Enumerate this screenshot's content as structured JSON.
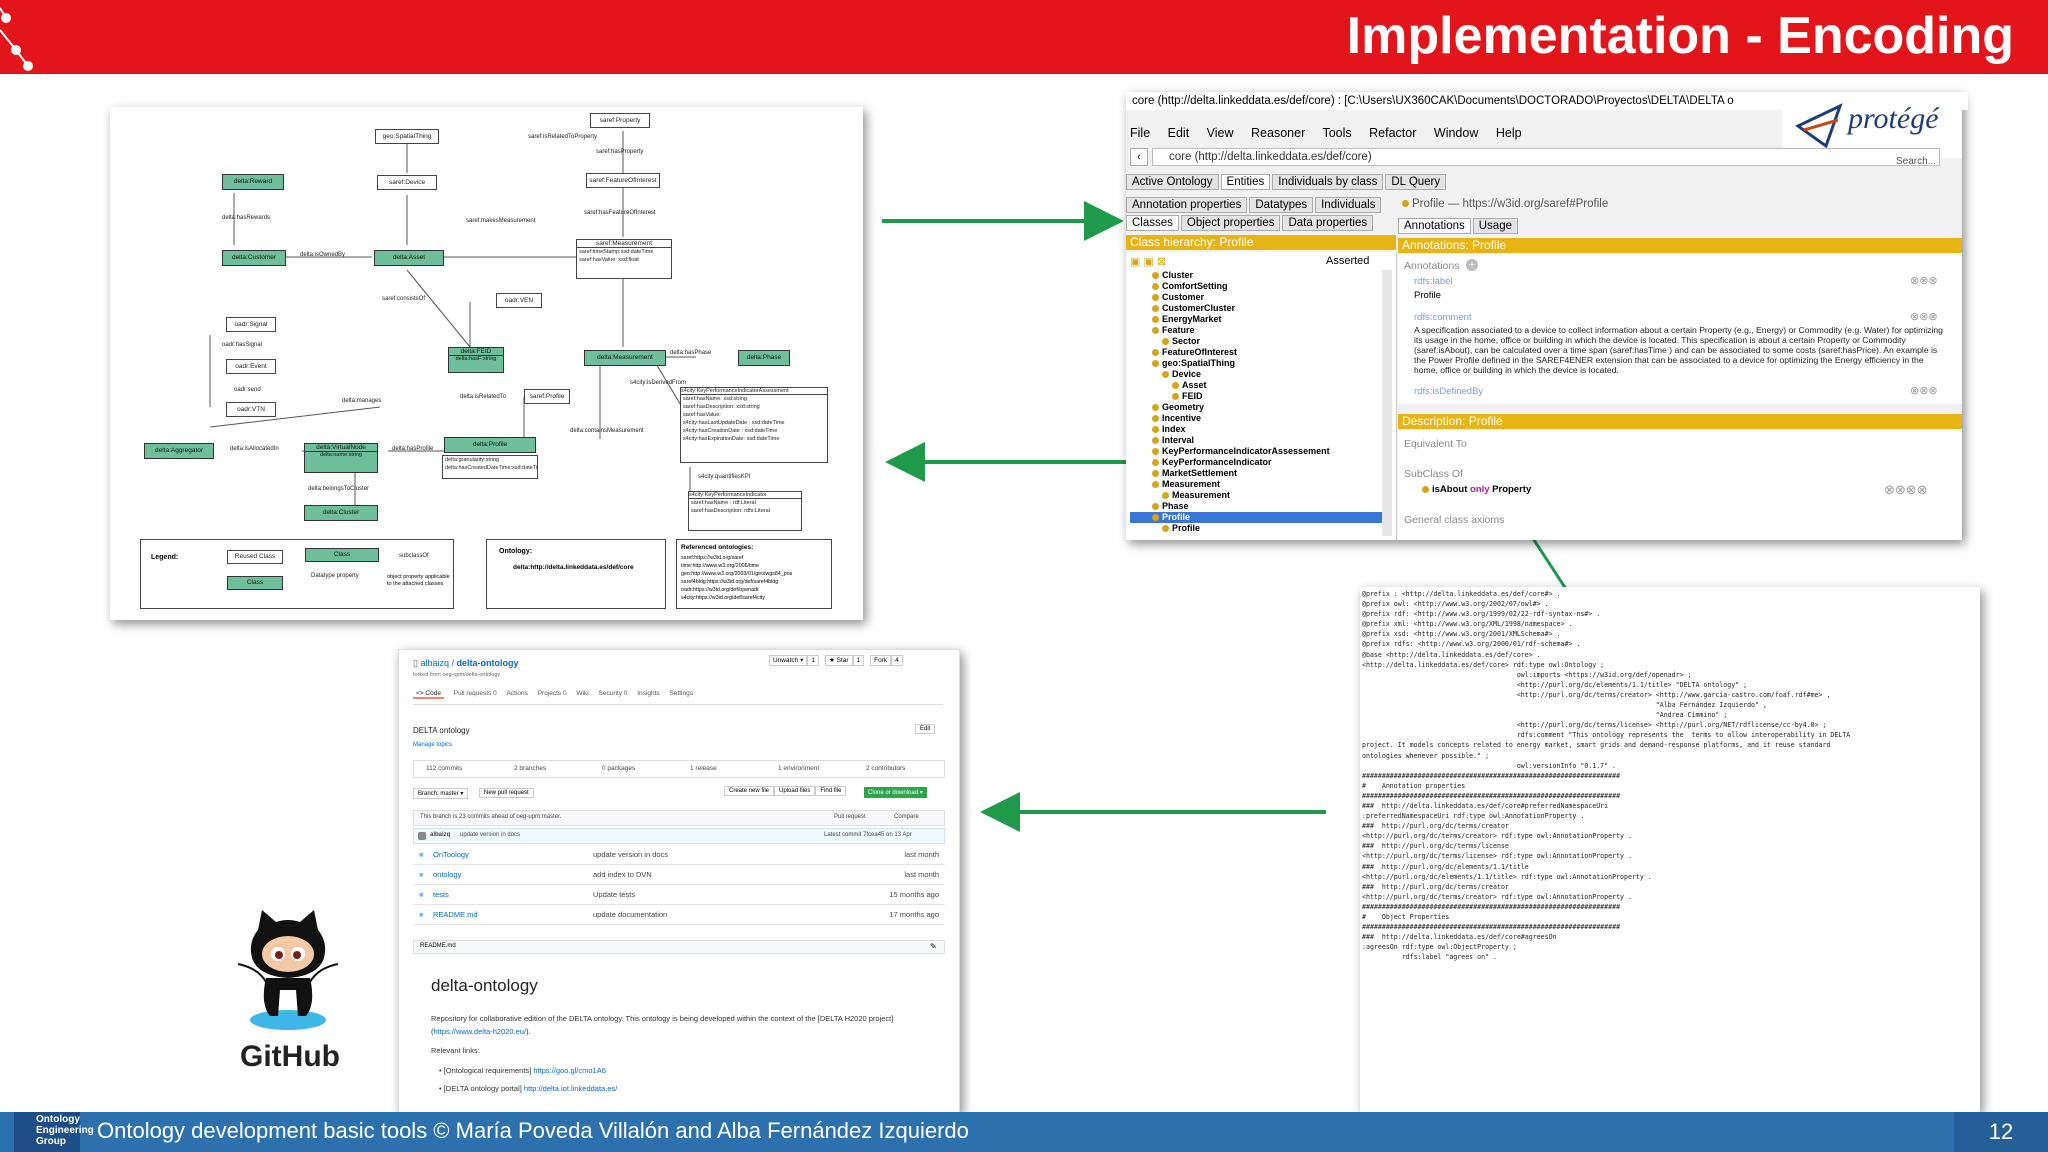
{
  "slide": {
    "title": "Implementation - Encoding",
    "footer_text": "Ontology development basic tools  © María Poveda Villalón  and Alba Fernández Izquierdo",
    "page_number": "12",
    "footer_logo_lines": [
      "Ontology",
      "Engineering",
      "Group"
    ],
    "colors": {
      "header": "#e3151b",
      "footer": "#2c70ae",
      "arrow": "#1f9a4a",
      "protege_bar": "#e7b416"
    }
  },
  "diagram": {
    "legend": {
      "title": "Legend:",
      "reused_class": "Reused Class",
      "class": "Class",
      "class2": "Class",
      "subclass_of": "subclassOf",
      "datatype_property": "Datatype property",
      "object_property": "object property applicable to the attached classes"
    },
    "ontology_label": "Ontology:",
    "ontology_uri": "delta:http://delta.linkeddata.es/def/core",
    "referenced_title": "Referenced ontologies:",
    "referenced": [
      "saref:https://w3id.org/saref",
      "time:http://www.w3.org/2006/time",
      "geo:http://www.w3.org/2003/01/geo/wgs84_pos",
      "saref4bldg:https://w3id.org/def/saref4bldg",
      "oadr:https://w3id.org/def/openadr",
      "s4city:https://w3id.org/def/saref4city"
    ],
    "nodes": {
      "reward": "delta:Reward",
      "customer": "delta:Customer",
      "asset": "delta:Asset",
      "device": "saref:Device",
      "spatial": "geo:SpatialThing",
      "property": "saref:Property",
      "feature": "saref:FeatureOfInterest",
      "measurement": "saref:Measurement",
      "feid": "delta:FEID",
      "dmeasurement": "delta:Measurement",
      "phase": "delta:Phase",
      "signal": "oadr:Signal",
      "event": "oadr:Event",
      "vtn": "oadr:VTN",
      "ven": "oadr:VEN",
      "aggregator": "delta:Aggregator",
      "virtualnode": "delta:VirtualNode",
      "dcluster": "delta:Cluster",
      "sprofile": "saref:Profile",
      "dprofile": "delta:Profile",
      "kpiassess": "s4city:KeyPerformanceIndicatorAssessment",
      "kpi": "s4city:KeyPerformanceIndicator"
    },
    "edges": {
      "hasRewards": "delta:hasRewards",
      "isOwnedBy": "delta:isOwnedBy",
      "isRelatedToProperty": "saref:isRelatedToProperty",
      "hasProperty": "saref:hasProperty",
      "makesMeasurement": "saref:makesMeasurement",
      "hasFeatureOfInterest": "saref:hasFeatureOfInterest",
      "consistsOf": "saref:consistsOf",
      "hasSignal": "oadr:hasSignal",
      "send": "oadr:send",
      "manages": "delta:manages",
      "isAllocatedIn": "delta:isAllocatedIn",
      "hasProfile": "delta:hasProfile",
      "belongsToCluster": "delta:belongsToCluster",
      "isRelatedTo": "delta:isRelatedTo",
      "containsMeasurement": "delta:containsMeasurement",
      "hasPhase": "delta:hasPhase",
      "isDerivedFrom": "s4city:isDerivedFrom",
      "quantifiesKPI": "s4city:quantifiesKPI"
    },
    "attrs": {
      "feid": "delta:hasF:string",
      "measurement": "saref:timeStamp:xsd:dateTime\nsaref:hasValue: xsd:float",
      "virtualnode": "delta:name:string",
      "dprofile": "delta:granularity:string\ndelta:hasCreatedDateTime:xsd:dateTime",
      "kpiassess": "saref:hasName: xsd:string\nsaref:hasDescription: xsd:string\nsaref:hasValue:\ns4city:hasLastUpdateDate : xsd:dateTime\ns4city:hasCreationDate : xsd:dateTime\ns4city:hasExpirationDate: xsd:dateTime",
      "kpi": "saref:hasName : rdf:Literal\nsaref:hasDescription: rdfs:Literal"
    }
  },
  "protege": {
    "window_title": "core (http://delta.linkeddata.es/def/core) : [C:\\Users\\UX360CAK\\Documents\\DOCTORADO\\Proyectos\\DELTA\\DELTA o",
    "logo_text": "protégé",
    "menu": [
      "File",
      "Edit",
      "View",
      "Reasoner",
      "Tools",
      "Refactor",
      "Window",
      "Help"
    ],
    "address": "core (http://delta.linkeddata.es/def/core)",
    "search_label": "Search...",
    "tabs": [
      "Active Ontology",
      "Entities",
      "Individuals by class",
      "DL Query"
    ],
    "left_tabs_row1": [
      "Annotation properties",
      "Datatypes",
      "Individuals"
    ],
    "left_tabs_row2": [
      "Classes",
      "Object properties",
      "Data properties"
    ],
    "class_hierarchy_label": "Class hierarchy: Profile",
    "asserted_label": "Asserted",
    "tree": [
      {
        "label": "Cluster",
        "indent": 1
      },
      {
        "label": "ComfortSetting",
        "indent": 1
      },
      {
        "label": "Customer",
        "indent": 1
      },
      {
        "label": "CustomerCluster",
        "indent": 1
      },
      {
        "label": "EnergyMarket",
        "indent": 1
      },
      {
        "label": "Feature",
        "indent": 1
      },
      {
        "label": "Sector",
        "indent": 2
      },
      {
        "label": "FeatureOfInterest",
        "indent": 1
      },
      {
        "label": "geo:SpatialThing",
        "indent": 1
      },
      {
        "label": "Device",
        "indent": 2
      },
      {
        "label": "Asset",
        "indent": 3
      },
      {
        "label": "FEID",
        "indent": 3
      },
      {
        "label": "Geometry",
        "indent": 1
      },
      {
        "label": "Incentive",
        "indent": 1
      },
      {
        "label": "Index",
        "indent": 1
      },
      {
        "label": "Interval",
        "indent": 1
      },
      {
        "label": "KeyPerformanceIndicatorAssessement",
        "indent": 1
      },
      {
        "label": "KeyPerformanceIndicator",
        "indent": 1
      },
      {
        "label": "MarketSettlement",
        "indent": 1
      },
      {
        "label": "Measurement",
        "indent": 1
      },
      {
        "label": "Measurement",
        "indent": 2
      },
      {
        "label": "Phase",
        "indent": 1
      },
      {
        "label": "Profile",
        "indent": 1,
        "selected": true
      },
      {
        "label": "Profile",
        "indent": 2
      }
    ],
    "entity_header": "Profile — https://w3id.org/saref#Profile",
    "right_tabs": [
      "Annotations",
      "Usage"
    ],
    "annotations_bar": "Annotations: Profile",
    "annotations_label": "Annotations",
    "rdfs_label": "rdfs:label",
    "label_value": "Profile",
    "rdfs_comment": "rdfs:comment",
    "comment_text": "A specification associated to a device to collect information about a certain Property (e.g., Energy) or Commodity (e.g. Water) for optimizing its usage in the home, office or building in which the device is located. This specification is about a certain Property or Commodity (saref:isAbout), can be calculated over a time span (saref:hasTime ) and can be associated to some costs (saref:hasPrice). An example is the Power Profile defined in the SAREF4ENER extension that can be associated to a device for optimizing the Energy efficiency in the home, office or building in which the device is located.",
    "rdfs_defined": "rdfs:isDefinedBy",
    "description_bar": "Description: Profile",
    "equivalent_to": "Equivalent To",
    "subclass_of": "SubClass Of",
    "subclass_value_a": "isAbout",
    "subclass_value_b": "only",
    "subclass_value_c": "Property",
    "general_axioms": "General class axioms"
  },
  "ttl": {
    "lines": [
      "@prefix : <http://delta.linkeddata.es/def/core#> .",
      "@prefix owl: <http://www.w3.org/2002/07/owl#> .",
      "@prefix rdf: <http://www.w3.org/1999/02/22-rdf-syntax-ns#> .",
      "@prefix xml: <http://www.w3.org/XML/1998/namespace> .",
      "@prefix xsd: <http://www.w3.org/2001/XMLSchema#> .",
      "@prefix rdfs: <http://www.w3.org/2000/01/rdf-schema#> .",
      "@base <http://delta.linkeddata.es/def/core> .",
      "",
      "<http://delta.linkeddata.es/def/core> rdf:type owl:Ontology ;",
      "                                       owl:imports <https://w3id.org/def/openadr> ;",
      "                                       <http://purl.org/dc/elements/1.1/title> \"DELTA ontology\" ;",
      "                                       <http://purl.org/dc/terms/creator> <http://www.garcia-castro.com/foaf.rdf#me> ,",
      "                                                                          \"Alba Fernández Izquierdo\" ,",
      "                                                                          \"Andrea Cimmino\" ;",
      "                                       <http://purl.org/dc/terms/license> <http://purl.org/NET/rdflicense/cc-by4.0> ;",
      "                                       rdfs:comment \"This ontology represents the  terms to allow interoperability in DELTA",
      "project. It models concepts related to energy market, smart grids and demand-response platforms, and it reuse standard",
      "ontologies whenever possible.\" ;",
      "                                       owl:versionInfo \"0.1.7\" .",
      "",
      "#################################################################",
      "#    Annotation properties",
      "#################################################################",
      "",
      "###  http://delta.linkeddata.es/def/core#preferredNamespaceUri",
      ":preferredNamespaceUri rdf:type owl:AnnotationProperty .",
      "",
      "",
      "###  http://purl.org/dc/terms/creator",
      "<http://purl.org/dc/terms/creator> rdf:type owl:AnnotationProperty .",
      "",
      "",
      "###  http://purl.org/dc/terms/license",
      "<http://purl.org/dc/terms/license> rdf:type owl:AnnotationProperty .",
      "",
      "",
      "###  http://purl.org/dc/elements/1.1/title",
      "<http://purl.org/dc/elements/1.1/title> rdf:type owl:AnnotationProperty .",
      "",
      "",
      "###  http://purl.org/dc/terms/creator",
      "<http://purl.org/dc/terms/creator> rdf:type owl:AnnotationProperty .",
      "",
      "",
      "#################################################################",
      "#    Object Properties",
      "#################################################################",
      "",
      "###  http://delta.linkeddata.es/def/core#agreesOn",
      ":agreesOn rdf:type owl:ObjectProperty ;",
      "          rdfs:label \"agrees on\" ."
    ]
  },
  "github": {
    "repo_owner": "albaizq",
    "repo_name": "delta-ontology",
    "forked_from": "forked from oeg-upm/delta-ontology",
    "watch": "Unwatch ▾",
    "watch_count": "1",
    "star": "★ Star",
    "star_count": "1",
    "fork": "Fork",
    "fork_count": "4",
    "nav": [
      "<> Code",
      "Pull requests 0",
      "Actions",
      "Projects 0",
      "Wiki",
      "Security 0",
      "Insights",
      "Settings"
    ],
    "description": "DELTA ontology",
    "edit": "Edit",
    "manage_topics": "Manage topics",
    "stats": [
      "112 commits",
      "2 branches",
      "0 packages",
      "1 release",
      "1 environment",
      "2 contributors"
    ],
    "branch": "Branch: master ▾",
    "new_pr": "New pull request",
    "file_buttons": [
      "Create new file",
      "Upload files",
      "Find file"
    ],
    "clone": "Clone or download ▾",
    "ahead_text": "This branch is 23 commits ahead of oeg-upm:master.",
    "pull_request": "Pull request",
    "compare": "Compare",
    "commit_author": "albaizq",
    "commit_msg": "update version in docs",
    "latest_commit": "Latest commit 7fcea45 on 13 Apr",
    "files": [
      {
        "name": "OnToology",
        "msg": "update version in docs",
        "age": "last month"
      },
      {
        "name": "ontology",
        "msg": "add index to DVN",
        "age": "last month"
      },
      {
        "name": "tests",
        "msg": "Update tests",
        "age": "15 months ago"
      },
      {
        "name": "README.md",
        "msg": "update documentation",
        "age": "17 months ago"
      }
    ],
    "readme_header": "README.md",
    "readme_title": "delta-ontology",
    "readme_p1": "Repository for collaborative edition of the DELTA ontology. This ontology is being developed within the context of the [DELTA H2020 project] (",
    "readme_p1_link": "https://www.delta-h2020.eu/",
    "readme_p1_end": ").",
    "relevant_links": "Relevant links:",
    "link1_text": "[Ontological requirements] ",
    "link1_url": "https://goo.gl/cmo1A6",
    "link2_text": "[DELTA ontology portal] ",
    "link2_url": "http://delta.iot.linkeddata.es/",
    "logo_text": "GitHub"
  }
}
